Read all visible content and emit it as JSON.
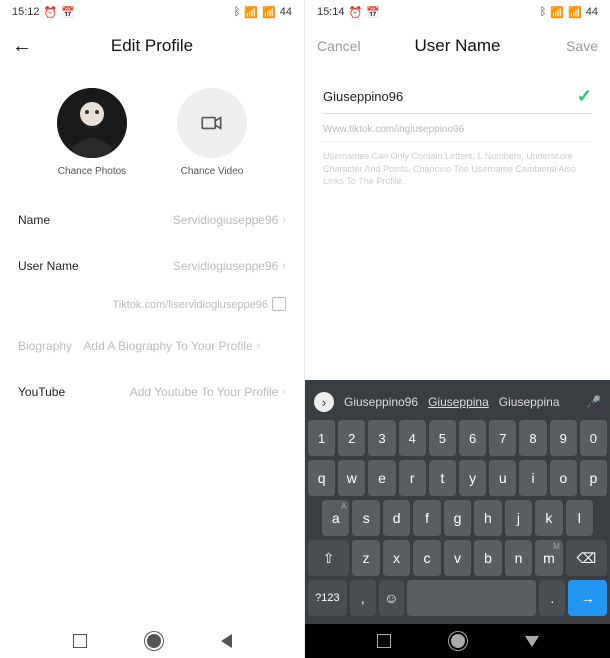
{
  "left": {
    "status": {
      "time": "15:12",
      "icons_left": [
        "alarm",
        "calendar"
      ],
      "icons_right": [
        "bt",
        "signal",
        "wifi",
        "battery"
      ],
      "battery": "44"
    },
    "nav": {
      "title": "Edit Profile"
    },
    "photos": {
      "change_photo": "Chance Photos",
      "change_video": "Chance Video"
    },
    "fields": {
      "name_label": "Name",
      "name_value": "Servidiogiuseppe96",
      "username_label": "User Name",
      "username_value": "Servidiogiuseppe96",
      "tiktok_url": "Tiktok.com/liservidiogiuseppe96",
      "bio_label": "Biography",
      "bio_value": "Add A Biography To Your Profile",
      "youtube_label": "YouTube",
      "youtube_value": "Add Youtube To Your Profile"
    }
  },
  "right": {
    "status": {
      "time": "15:14",
      "battery": "44"
    },
    "nav": {
      "cancel": "Cancel",
      "title": "User Name",
      "save": "Save"
    },
    "input": {
      "value": "Giuseppino96"
    },
    "url": "Www.tiktok.com/ingiuseppino96",
    "help": "Usernames Can Only Contain Letters, L Numbers, Underscore Character And Points. Chancino The Username Cambierai Also Links To The Profile.",
    "keyboard": {
      "suggestions": [
        "Giuseppino96",
        "Giuseppina",
        "Giuseppina"
      ],
      "row_num": [
        "1",
        "2",
        "3",
        "4",
        "5",
        "6",
        "7",
        "8",
        "9",
        "0"
      ],
      "row1": [
        "q",
        "w",
        "e",
        "r",
        "t",
        "y",
        "u",
        "i",
        "o",
        "p"
      ],
      "row2": [
        "a",
        "s",
        "d",
        "f",
        "g",
        "h",
        "j",
        "k",
        "l"
      ],
      "row3": [
        "z",
        "x",
        "c",
        "v",
        "b",
        "n",
        "m"
      ],
      "shift": "⇧",
      "del": "⌫",
      "sym": "?123",
      "comma": ",",
      "emoji": "☺",
      "period": ".",
      "enter": "→"
    }
  }
}
